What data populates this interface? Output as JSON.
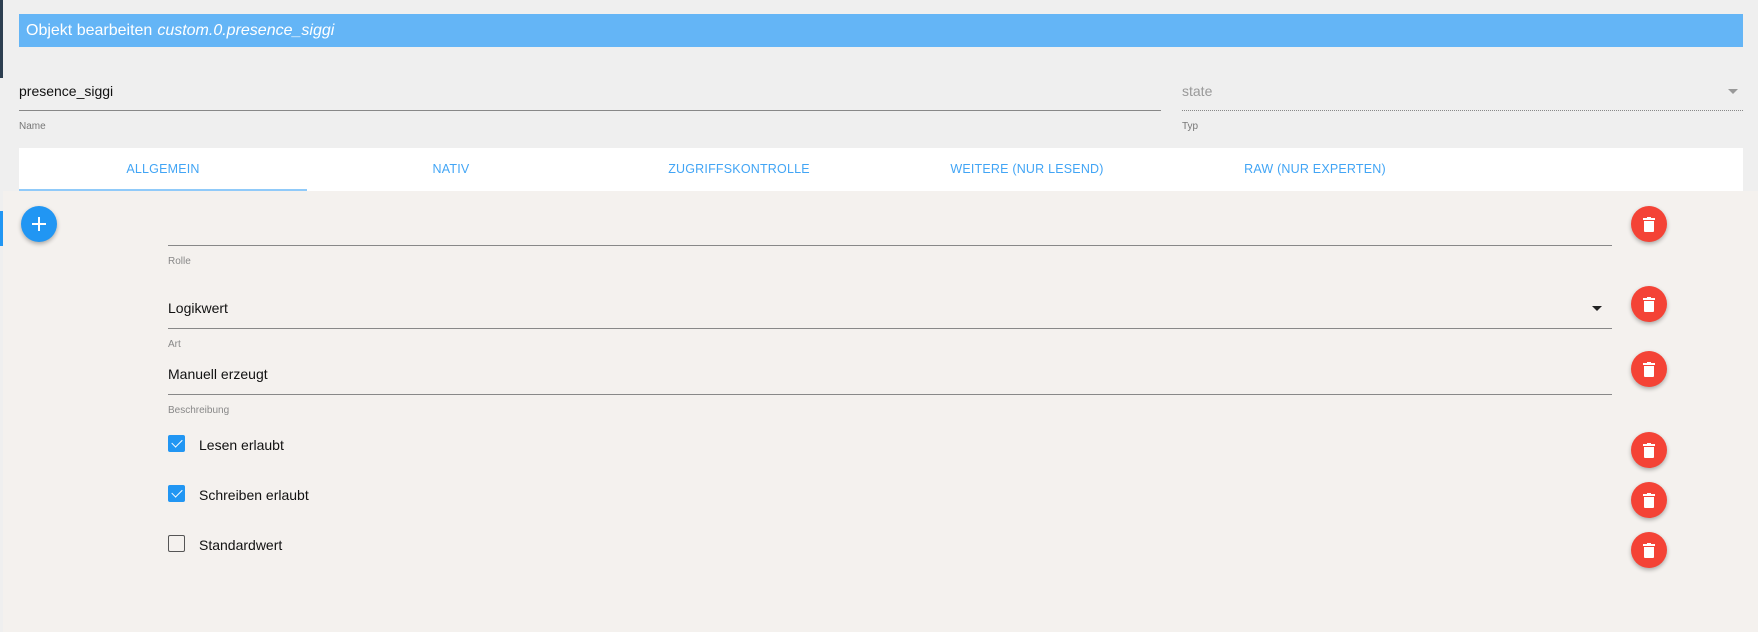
{
  "header": {
    "prefix": "Objekt bearbeiten",
    "object_id": "custom.0.presence_siggi"
  },
  "name_field": {
    "value": "presence_siggi",
    "label": "Name"
  },
  "type_field": {
    "value": "state",
    "label": "Typ"
  },
  "tabs": [
    {
      "label": "ALLGEMEIN",
      "active": true
    },
    {
      "label": "NATIV",
      "active": false
    },
    {
      "label": "ZUGRIFFSKONTROLLE",
      "active": false
    },
    {
      "label": "WEITERE (NUR LESEND)",
      "active": false
    },
    {
      "label": "RAW (NUR EXPERTEN)",
      "active": false
    }
  ],
  "fields": {
    "rolle": {
      "value": "",
      "label": "Rolle"
    },
    "art": {
      "value": "Logikwert",
      "label": "Art"
    },
    "beschreibung": {
      "value": "Manuell erzeugt",
      "label": "Beschreibung"
    }
  },
  "checkboxes": {
    "lesen": {
      "label": "Lesen erlaubt",
      "checked": true
    },
    "schreiben": {
      "label": "Schreiben erlaubt",
      "checked": true
    },
    "standardwert": {
      "label": "Standardwert",
      "checked": false
    }
  },
  "colors": {
    "header_bg": "#64b5f6",
    "accent": "#2196f3",
    "delete": "#f44336",
    "tab_text": "#42a5f5"
  },
  "icons": {
    "add": "plus-icon",
    "delete": "trash-icon",
    "dropdown": "caret-down-icon",
    "check": "checkmark-icon"
  }
}
